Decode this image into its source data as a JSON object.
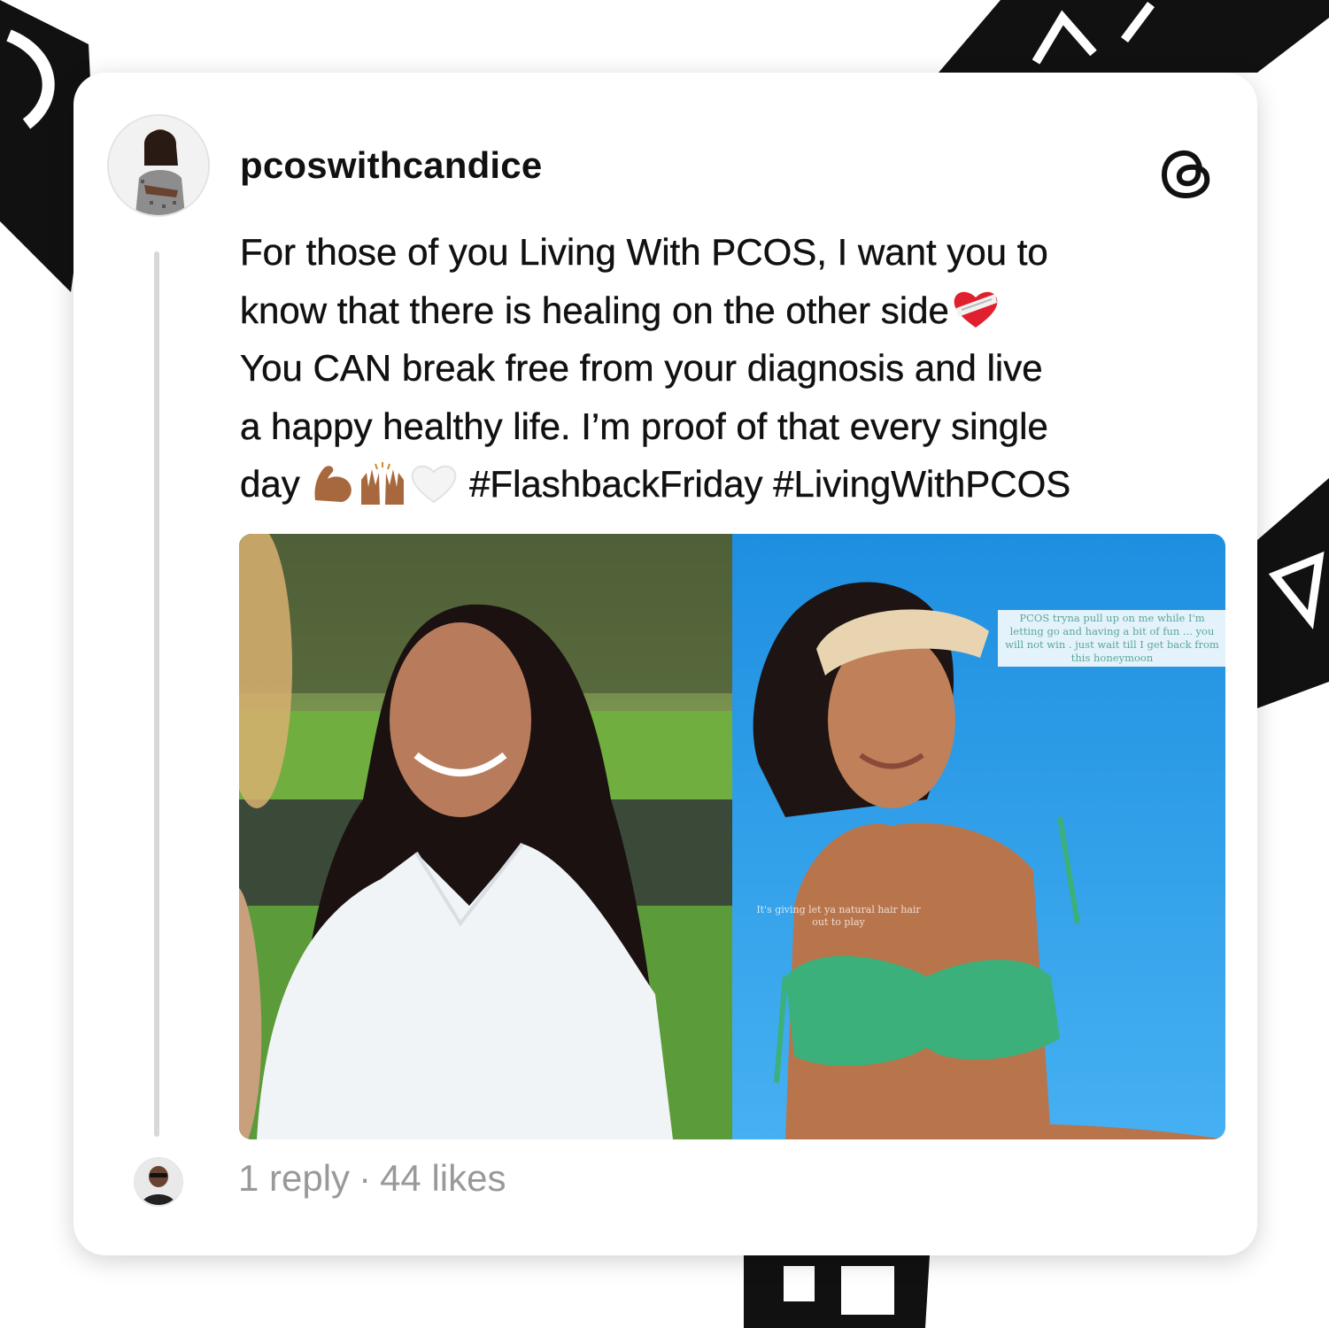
{
  "post": {
    "username": "pcoswithcandice",
    "lines": [
      "For those of you Living With PCOS, I want you to",
      "know that there is healing on the other side",
      "You CAN break free from your diagnosis and live",
      "a happy healthy life. I’m proof of that every single",
      "day",
      "#FlashbackFriday #LivingWithPCOS"
    ],
    "emojis": [
      "mending-heart-icon",
      "flexed-biceps-icon",
      "raising-hands-icon",
      "white-heart-icon"
    ],
    "story_caption": "PCOS tryna pull up on me while I'm letting go and having a bit of fun ... you will not win . just wait till I get back from this honeymoon",
    "story_caption_2": "It's giving let ya natural hair hair out to play"
  },
  "footer": {
    "replies": "1 reply",
    "separator": "·",
    "likes": "44 likes"
  },
  "colors": {
    "text": "#111111",
    "muted": "#999999",
    "thread_line": "#d8d8d8",
    "card_bg": "#ffffff"
  }
}
